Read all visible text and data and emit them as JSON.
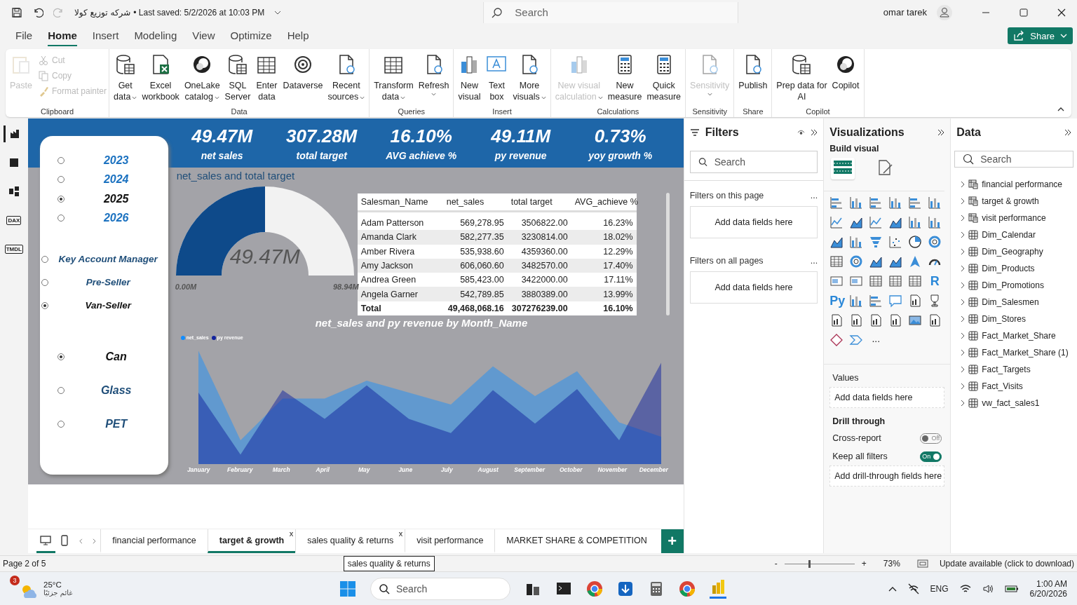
{
  "title_bar": {
    "file_name": "شركه توزيع كولا",
    "saved": "• Last saved: 5/2/2026 at 10:03 PM",
    "search": {
      "placeholder": "Search"
    },
    "user": "omar tarek",
    "redo_disabled": true
  },
  "menu": [
    {
      "label": "File",
      "selected": false
    },
    {
      "label": "Home",
      "selected": true
    },
    {
      "label": "Insert",
      "selected": false
    },
    {
      "label": "Modeling",
      "selected": false
    },
    {
      "label": "View",
      "selected": false
    },
    {
      "label": "Optimize",
      "selected": false
    },
    {
      "label": "Help",
      "selected": false
    }
  ],
  "share_button": "Share",
  "ribbon": [
    {
      "label": "Clipboard",
      "buttons": [
        {
          "kind": "large",
          "lines": [
            "Paste"
          ],
          "dropdown": false,
          "disabled": true
        },
        {
          "kind": "small",
          "lines": [
            "Cut"
          ],
          "dropdown": false,
          "disabled": true
        },
        {
          "kind": "small",
          "lines": [
            "Copy"
          ],
          "dropdown": false,
          "disabled": true
        },
        {
          "kind": "small",
          "lines": [
            "Format painter"
          ],
          "dropdown": false,
          "disabled": true
        }
      ]
    },
    {
      "label": "Data",
      "buttons": [
        {
          "kind": "large",
          "lines": [
            "Get",
            "data"
          ],
          "dropdown": true,
          "disabled": false
        },
        {
          "kind": "large",
          "lines": [
            "Excel",
            "workbook"
          ],
          "dropdown": false,
          "disabled": false
        },
        {
          "kind": "large",
          "lines": [
            "OneLake",
            "catalog"
          ],
          "dropdown": true,
          "disabled": false
        },
        {
          "kind": "large",
          "lines": [
            "SQL",
            "Server"
          ],
          "dropdown": false,
          "disabled": false
        },
        {
          "kind": "large",
          "lines": [
            "Enter",
            "data"
          ],
          "dropdown": false,
          "disabled": false
        },
        {
          "kind": "large",
          "lines": [
            "Dataverse"
          ],
          "dropdown": false,
          "disabled": false
        },
        {
          "kind": "large",
          "lines": [
            "Recent",
            "sources"
          ],
          "dropdown": true,
          "disabled": false
        }
      ]
    },
    {
      "label": "Queries",
      "buttons": [
        {
          "kind": "large",
          "lines": [
            "Transform",
            "data"
          ],
          "dropdown": true,
          "disabled": false
        },
        {
          "kind": "large",
          "lines": [
            "Refresh"
          ],
          "dropdown": true,
          "disabled": false
        }
      ]
    },
    {
      "label": "Insert",
      "buttons": [
        {
          "kind": "large",
          "lines": [
            "New",
            "visual"
          ],
          "dropdown": false,
          "disabled": false
        },
        {
          "kind": "large",
          "lines": [
            "Text",
            "box"
          ],
          "dropdown": false,
          "disabled": false
        },
        {
          "kind": "large",
          "lines": [
            "More",
            "visuals"
          ],
          "dropdown": true,
          "disabled": false
        }
      ]
    },
    {
      "label": "Calculations",
      "buttons": [
        {
          "kind": "large",
          "lines": [
            "New visual",
            "calculation"
          ],
          "dropdown": true,
          "disabled": true
        },
        {
          "kind": "large",
          "lines": [
            "New",
            "measure"
          ],
          "dropdown": false,
          "disabled": false
        },
        {
          "kind": "large",
          "lines": [
            "Quick",
            "measure"
          ],
          "dropdown": false,
          "disabled": false
        }
      ]
    },
    {
      "label": "Sensitivity",
      "buttons": [
        {
          "kind": "large",
          "lines": [
            "Sensitivity"
          ],
          "dropdown": true,
          "disabled": true
        }
      ]
    },
    {
      "label": "Share",
      "buttons": [
        {
          "kind": "large",
          "lines": [
            "Publish"
          ],
          "dropdown": false,
          "disabled": false
        }
      ]
    },
    {
      "label": "Copilot",
      "buttons": [
        {
          "kind": "large",
          "lines": [
            "Prep data for",
            "AI"
          ],
          "dropdown": false,
          "disabled": false
        },
        {
          "kind": "large",
          "lines": [
            "Copilot"
          ],
          "dropdown": false,
          "disabled": false
        }
      ]
    }
  ],
  "rail": [
    {
      "selected": true
    },
    {
      "selected": false
    },
    {
      "selected": false
    },
    {
      "glyph": "DAX",
      "selected": false
    },
    {
      "glyph": "TMDL",
      "selected": false
    }
  ],
  "report": {
    "kpis": [
      {
        "value": "49.47M",
        "label": "net sales"
      },
      {
        "value": "307.28M",
        "label": "total target"
      },
      {
        "value": "16.10%",
        "label": "AVG achieve %"
      },
      {
        "value": "49.11M",
        "label": "py revenue"
      },
      {
        "value": "0.73%",
        "label": "yoy growth %"
      }
    ],
    "year_slicer": [
      {
        "label": "2023",
        "selected": false
      },
      {
        "label": "2024",
        "selected": false
      },
      {
        "label": "2025",
        "selected": true
      },
      {
        "label": "2026",
        "selected": false
      }
    ],
    "role_slicer": [
      {
        "label": "Key Account Manager",
        "selected": false
      },
      {
        "label": "Pre-Seller",
        "selected": false
      },
      {
        "label": "Van-Seller",
        "selected": true
      }
    ],
    "package_slicer": [
      {
        "label": "Can",
        "selected": true
      },
      {
        "label": "Glass",
        "selected": false
      },
      {
        "label": "PET",
        "selected": false
      }
    ],
    "gauge": {
      "title": "net_sales and total target",
      "value": "49.47M",
      "min": "0.00M",
      "max": "98.94M",
      "level": 0.5
    },
    "table": {
      "columns": [
        "Salesman_Name",
        "net_sales",
        "total target",
        "AVG_achieve %"
      ],
      "rows": [
        [
          "Adam Patterson",
          "569,278.95",
          "3506822.00",
          "16.23%"
        ],
        [
          "Amanda Clark",
          "582,277.35",
          "3230814.00",
          "18.02%"
        ],
        [
          "Amber Rivera",
          "535,938.60",
          "4359360.00",
          "12.29%"
        ],
        [
          "Amy Jackson",
          "606,060.60",
          "3482570.00",
          "17.40%"
        ],
        [
          "Andrea Green",
          "585,423.00",
          "3422000.00",
          "17.11%"
        ],
        [
          "Angela Garner",
          "542,789.85",
          "3880389.00",
          "13.99%"
        ]
      ],
      "total": [
        "Total",
        "49,468,068.16",
        "307276239.00",
        "16.10%"
      ]
    },
    "area_chart": {
      "title": "net_sales and py revenue by Month_Name",
      "legend": [
        {
          "label": "net_sales",
          "color": "#118dff"
        },
        {
          "label": "py revenue",
          "color": "#12239e"
        }
      ],
      "months": [
        "January",
        "February",
        "March",
        "April",
        "May",
        "June",
        "July",
        "August",
        "September",
        "October",
        "November",
        "December"
      ]
    }
  },
  "filters": {
    "title": "Filters",
    "search": {
      "placeholder": "Search"
    },
    "sections": [
      {
        "label": "Filters on this page",
        "more": "...",
        "well": "Add data fields here"
      },
      {
        "label": "Filters on all pages",
        "more": "...",
        "well": "Add data fields here"
      }
    ]
  },
  "visualizations": {
    "title": "Visualizations",
    "subtitle": "Build visual",
    "build_tabs": [
      {
        "selected": true
      },
      {
        "selected": false
      }
    ],
    "glyphs": [
      "R",
      "Py"
    ],
    "more": "...",
    "values_label": "Values",
    "values_well": "Add data fields here",
    "drill_label": "Drill through",
    "toggles": [
      {
        "label": "Cross-report",
        "on": false,
        "text": "Off"
      },
      {
        "label": "Keep all filters",
        "on": true,
        "text": "On"
      }
    ],
    "drill_well": "Add drill-through fields here"
  },
  "data_pane": {
    "title": "Data",
    "search": {
      "placeholder": "Search"
    },
    "tables": [
      {
        "name": "financial performance",
        "kind": "measure"
      },
      {
        "name": "target & growth",
        "kind": "measure"
      },
      {
        "name": "visit performance",
        "kind": "measure"
      },
      {
        "name": "Dim_Calendar",
        "kind": "table"
      },
      {
        "name": "Dim_Geography",
        "kind": "table"
      },
      {
        "name": "Dim_Products",
        "kind": "table"
      },
      {
        "name": "Dim_Promotions",
        "kind": "table"
      },
      {
        "name": "Dim_Salesmen",
        "kind": "table"
      },
      {
        "name": "Dim_Stores",
        "kind": "table"
      },
      {
        "name": "Fact_Market_Share",
        "kind": "table"
      },
      {
        "name": "Fact_Market_Share (1)",
        "kind": "table"
      },
      {
        "name": "Fact_Targets",
        "kind": "table"
      },
      {
        "name": "Fact_Visits",
        "kind": "table"
      },
      {
        "name": "vw_fact_sales1",
        "kind": "table"
      }
    ]
  },
  "page_tabs": {
    "views": [
      {
        "selected": true
      },
      {
        "selected": false
      }
    ],
    "tabs": [
      {
        "label": "financial performance",
        "selected": false
      },
      {
        "label": "target & growth",
        "selected": true,
        "close": "x"
      },
      {
        "label": "sales quality & returns",
        "selected": false,
        "close": "x"
      },
      {
        "label": "visit performance",
        "selected": false
      },
      {
        "label": "MARKET SHARE & COMPETITION",
        "selected": false
      }
    ],
    "add": "+",
    "tooltip": "sales quality & returns"
  },
  "status_bar": {
    "page": "Page 2 of 5",
    "zoom_out": "-",
    "zoom_in": "+",
    "zoom": {
      "level": 0.34
    },
    "zoom_text": "73%",
    "update": "Update available (click to download)"
  },
  "taskbar": {
    "weather_badge": "3",
    "temperature": "25°C",
    "condition": "غائم جزئيًا",
    "search": {
      "placeholder": "Search"
    },
    "language": "ENG",
    "time": "1:00 AM",
    "date": "6/20/2026"
  }
}
